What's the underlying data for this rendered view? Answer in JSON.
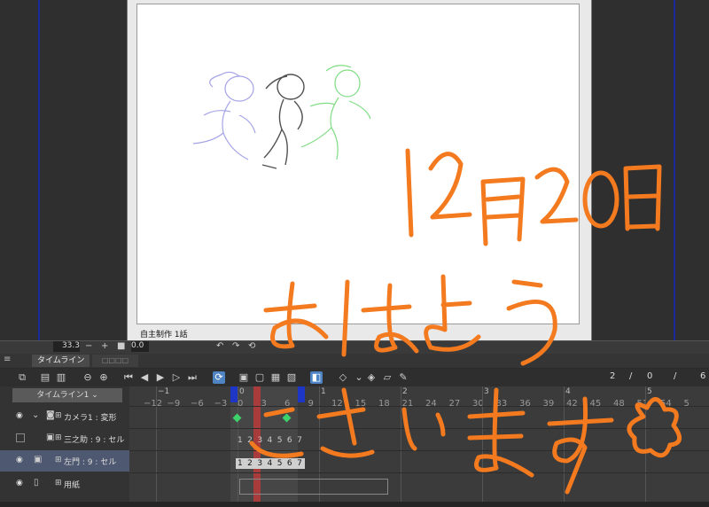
{
  "canvas": {
    "paper_caption": "自主制作 1話",
    "handwritten_date": "12月20日",
    "handwritten_line1": "おはよう",
    "handwritten_line2": "ございます✿"
  },
  "zoom_bar": {
    "zoom": "33.3",
    "minus": "−",
    "plus": "+",
    "frame_field": "0.0"
  },
  "panel": {
    "menu_glyph": "≡",
    "tab_timeline": "タイムライン",
    "tab_other": "□□□□"
  },
  "toolbar": {
    "frame_current": "2",
    "sep1": "/",
    "frame_mid": "0",
    "sep2": "/",
    "frame_total": "6"
  },
  "timeline": {
    "selector": "タイムライン1",
    "layers": [
      {
        "name": "カメラ1 : 変形",
        "visible": true,
        "selected": false
      },
      {
        "name": "三之助 : 9 : セル",
        "visible": false,
        "selected": false
      },
      {
        "name": "左門 : 9 : セル",
        "visible": true,
        "selected": true
      },
      {
        "name": "用紙",
        "visible": true,
        "selected": false
      }
    ],
    "ticks": [
      "−12",
      "−9",
      "−6",
      "−3",
      "0",
      "3",
      "6",
      "9",
      "12",
      "15",
      "18",
      "21",
      "24",
      "27",
      "30",
      "33",
      "36",
      "39",
      "42",
      "45",
      "48",
      "51",
      "54",
      "5"
    ],
    "seconds": [
      "−1",
      "0",
      "1",
      "2",
      "3",
      "4",
      "5"
    ],
    "playhead_labels": [
      "0",
      "2",
      "0"
    ],
    "cells_row_a": "1 2 3 4 5 6 7",
    "cells_row_b": "1 2 3 4 5 6 7"
  },
  "colors": {
    "accent": "#4f84c4",
    "playhead": "#b33a3a",
    "keyframe": "#3dd26a",
    "handwriting": "#f47a1f",
    "marker_blue": "#1d36c6"
  }
}
